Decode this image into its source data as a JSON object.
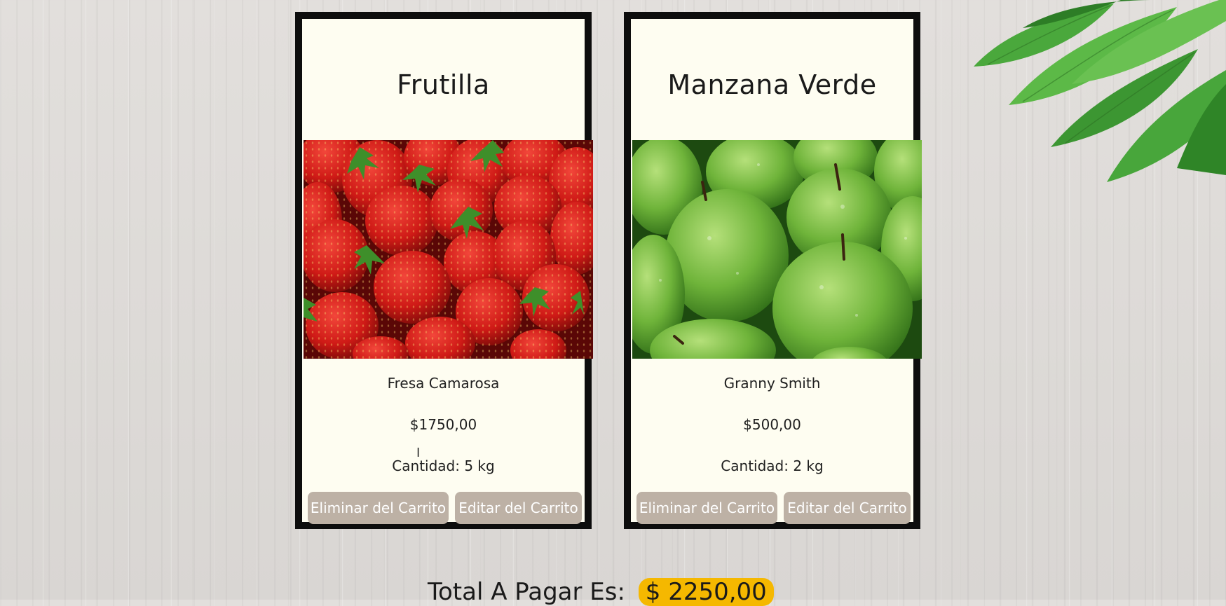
{
  "products": [
    {
      "title": "Frutilla",
      "image": "strawberries-photo",
      "variety": "Fresa Camarosa",
      "price": "$1750,00",
      "quantity": "Cantidad: 5 kg",
      "remove_label": "Eliminar del Carrito",
      "edit_label": "Editar del Carrito"
    },
    {
      "title": "Manzana Verde",
      "image": "green-apples-photo",
      "variety": "Granny Smith",
      "price": "$500,00",
      "quantity": "Cantidad: 2 kg",
      "remove_label": "Eliminar del Carrito",
      "edit_label": "Editar del Carrito"
    }
  ],
  "total": {
    "label": "Total A Pagar Es:",
    "amount": "$ 2250,00"
  },
  "colors": {
    "card_background": "#fefdf1",
    "card_border": "#0d0d0d",
    "button": "#bdb1a5",
    "total_highlight": "#f5b800"
  }
}
